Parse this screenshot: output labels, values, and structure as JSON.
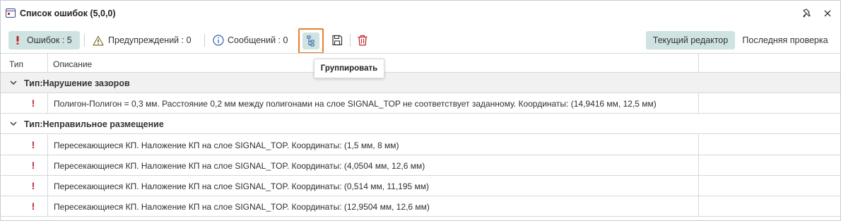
{
  "window": {
    "title": "Список ошибок (5,0,0)"
  },
  "toolbar": {
    "errors_label": "Ошибок : 5",
    "warnings_label": "Предупреждений : 0",
    "messages_label": "Сообщений : 0",
    "current_editor_label": "Текущий редактор",
    "last_check_label": "Последняя проверка"
  },
  "tooltip": {
    "text": "Группировать"
  },
  "table": {
    "columns": {
      "type": "Тип",
      "description": "Описание"
    },
    "groups": [
      {
        "label": "Тип:Нарушение зазоров",
        "rows": [
          "Полигон-Полигон = 0,3 мм. Расстояние 0,2 мм между полигонами на слое SIGNAL_TOP не соответствует заданному. Координаты: (14,9416 мм, 12,5 мм)"
        ]
      },
      {
        "label": "Тип:Неправильное размещение",
        "rows": [
          "Пересекающиеся КП. Наложение КП на слое SIGNAL_TOP. Координаты: (1,5 мм, 8 мм)",
          "Пересекающиеся КП. Наложение КП на слое SIGNAL_TOP. Координаты: (4,0504 мм, 12,6 мм)",
          "Пересекающиеся КП. Наложение КП на слое SIGNAL_TOP. Координаты: (0,514 мм, 11,195 мм)",
          "Пересекающиеся КП. Наложение КП на слое SIGNAL_TOP. Координаты: (12,9504 мм, 12,6 мм)"
        ]
      }
    ],
    "error_mark": "!"
  },
  "icons": {
    "title": "error-list-window-icon",
    "pin": "pin-icon",
    "close": "close-icon",
    "errors": "exclamation-icon",
    "warnings": "warning-triangle-icon",
    "messages": "info-circle-icon",
    "group": "group-tree-icon",
    "save": "save-icon",
    "delete": "trash-icon",
    "expand": "chevron-down-icon"
  },
  "colors": {
    "accent_bg": "#cfe3e2",
    "error_red": "#c0262d",
    "highlight_orange": "#e8802a",
    "warning_stroke": "#8a6d1f",
    "info_blue": "#2f5fa8"
  }
}
